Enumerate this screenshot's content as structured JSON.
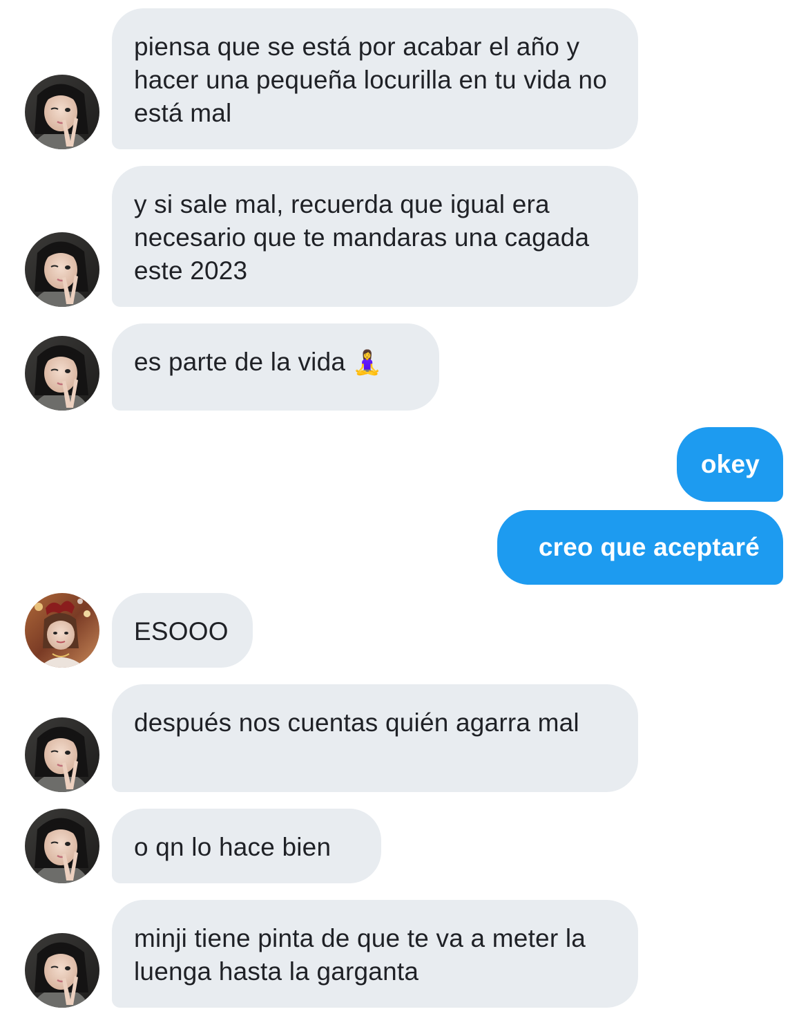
{
  "conversation": {
    "messages": [
      {
        "sender": "other",
        "avatar": "avatar-girl-peace",
        "text": "piensa que se está por acabar el año y hacer una pequeña locurilla en tu vida no está mal"
      },
      {
        "sender": "other",
        "avatar": "avatar-girl-peace",
        "text": "y si sale mal, recuerda que igual era necesario que te mandaras una cagada este 2023"
      },
      {
        "sender": "other",
        "avatar": "avatar-girl-peace",
        "text": "es parte de la vida",
        "emoji": "🧘‍♀️"
      },
      {
        "sender": "me",
        "text": "okey"
      },
      {
        "sender": "me",
        "text": "creo que aceptaré"
      },
      {
        "sender": "other",
        "avatar": "avatar-girl-party",
        "text": "ESOOO"
      },
      {
        "sender": "other",
        "avatar": "avatar-girl-peace",
        "text": "después nos cuentas quién agarra mal"
      },
      {
        "sender": "other",
        "avatar": "avatar-girl-peace",
        "text": "o qn lo hace bien"
      },
      {
        "sender": "other",
        "avatar": "avatar-girl-peace",
        "text": "minji tiene pinta de que te va a meter la luenga hasta la garganta"
      }
    ]
  },
  "colors": {
    "incoming_bubble": "#e8ecf0",
    "outgoing_bubble": "#1d9bf0",
    "incoming_text": "#1f2126",
    "outgoing_text": "#ffffff"
  }
}
